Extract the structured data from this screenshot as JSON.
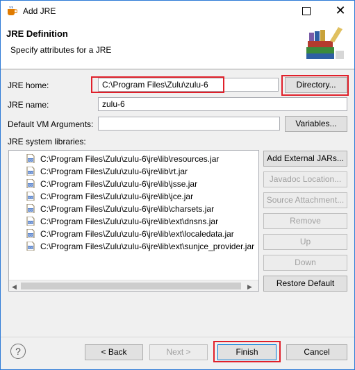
{
  "window": {
    "title": "Add JRE"
  },
  "header": {
    "title": "JRE Definition",
    "subtitle": "Specify attributes for a JRE"
  },
  "jre_home": {
    "label": "JRE home:",
    "value": "C:\\Program Files\\Zulu\\zulu-6",
    "button": "Directory..."
  },
  "jre_name": {
    "label": "JRE name:",
    "value": "zulu-6"
  },
  "vm_args": {
    "label": "Default VM Arguments:",
    "value": "",
    "button": "Variables..."
  },
  "libraries": {
    "label": "JRE system libraries:",
    "items": [
      "C:\\Program Files\\Zulu\\zulu-6\\jre\\lib\\resources.jar",
      "C:\\Program Files\\Zulu\\zulu-6\\jre\\lib\\rt.jar",
      "C:\\Program Files\\Zulu\\zulu-6\\jre\\lib\\jsse.jar",
      "C:\\Program Files\\Zulu\\zulu-6\\jre\\lib\\jce.jar",
      "C:\\Program Files\\Zulu\\zulu-6\\jre\\lib\\charsets.jar",
      "C:\\Program Files\\Zulu\\zulu-6\\jre\\lib\\ext\\dnsns.jar",
      "C:\\Program Files\\Zulu\\zulu-6\\jre\\lib\\ext\\localedata.jar",
      "C:\\Program Files\\Zulu\\zulu-6\\jre\\lib\\ext\\sunjce_provider.jar"
    ],
    "buttons": {
      "add_external": "Add External JARs...",
      "javadoc": "Javadoc Location...",
      "source": "Source Attachment...",
      "remove": "Remove",
      "up": "Up",
      "down": "Down",
      "restore": "Restore Default"
    }
  },
  "footer": {
    "back": "< Back",
    "next": "Next >",
    "finish": "Finish",
    "cancel": "Cancel"
  },
  "icons": {
    "app": "jre-cup-icon",
    "header": "books-icon",
    "jar": "jar-file-icon",
    "help": "help-icon"
  },
  "colors": {
    "highlight": "#e0202a",
    "border": "#2b79d6"
  }
}
